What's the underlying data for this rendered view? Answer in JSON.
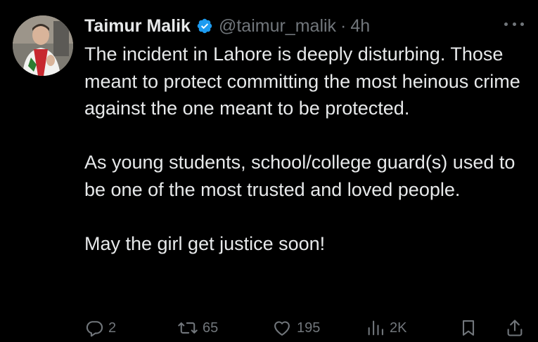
{
  "author": {
    "name": "Taimur Malik",
    "handle": "@taimur_malik",
    "separator": "·",
    "time": "4h",
    "verified": true
  },
  "tweet": {
    "paragraphs": [
      "The incident in Lahore is deeply disturbing. Those meant to protect committing the most heinous crime against the one meant to be protected.",
      "As young students, school/college guard(s) used to be one of the most trusted and loved people.",
      "May the girl get justice soon!"
    ]
  },
  "actions": {
    "replies": "2",
    "reposts": "65",
    "likes": "195",
    "views": "2K"
  },
  "icons": {
    "verified": "verified-badge-icon",
    "more": "more-horizontal-icon",
    "reply": "reply-icon",
    "repost": "repost-icon",
    "like": "heart-icon",
    "views": "views-bar-chart-icon",
    "bookmark": "bookmark-icon",
    "share": "share-icon"
  },
  "colors": {
    "background": "#000000",
    "text": "#e7e9ea",
    "muted": "#71767b",
    "verified": "#1d9bf0"
  }
}
